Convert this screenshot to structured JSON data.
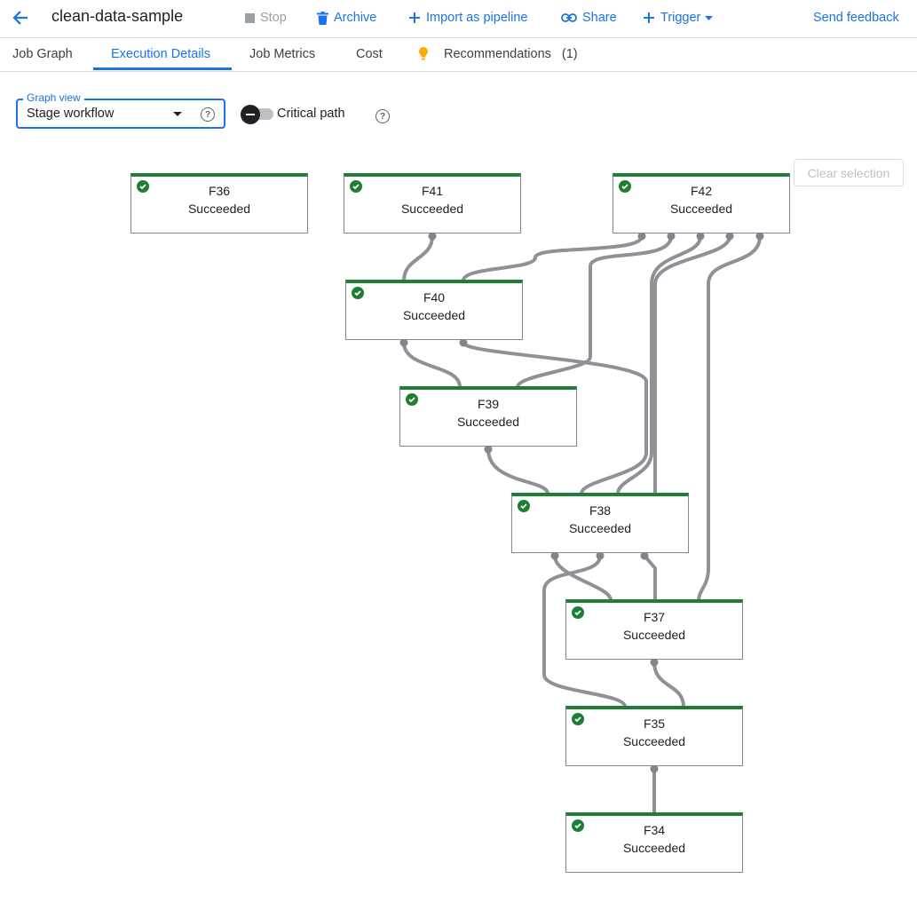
{
  "header": {
    "title": "clean-data-sample",
    "stop_label": "Stop",
    "archive_label": "Archive",
    "import_label": "Import as pipeline",
    "share_label": "Share",
    "trigger_label": "Trigger",
    "feedback_label": "Send feedback"
  },
  "tabs": [
    {
      "label": "Job Graph"
    },
    {
      "label": "Execution Details",
      "active": true
    },
    {
      "label": "Job Metrics"
    },
    {
      "label": "Cost"
    },
    {
      "label": "Recommendations",
      "count": "(1)"
    }
  ],
  "controls": {
    "graph_view_label": "Graph view",
    "graph_view_value": "Stage workflow",
    "critical_path_label": "Critical path",
    "critical_path_on": false,
    "clear_selection_label": "Clear selection"
  },
  "colors": {
    "accent": "#1a73e8",
    "success": "#1e7e34",
    "edge": "#8e9195"
  },
  "icons": [
    "back-arrow-icon",
    "stop-icon",
    "trash-icon",
    "plus-icon",
    "link-icon",
    "lightbulb-icon",
    "help-icon",
    "check-circle-icon"
  ],
  "graph": {
    "nodes": [
      {
        "name": "F36",
        "status": "Succeeded"
      },
      {
        "name": "F41",
        "status": "Succeeded"
      },
      {
        "name": "F42",
        "status": "Succeeded"
      },
      {
        "name": "F40",
        "status": "Succeeded"
      },
      {
        "name": "F39",
        "status": "Succeeded"
      },
      {
        "name": "F38",
        "status": "Succeeded"
      },
      {
        "name": "F37",
        "status": "Succeeded"
      },
      {
        "name": "F35",
        "status": "Succeeded"
      },
      {
        "name": "F34",
        "status": "Succeeded"
      }
    ],
    "edges": [
      [
        "F41",
        "F40"
      ],
      [
        "F42",
        "F40"
      ],
      [
        "F42",
        "F39"
      ],
      [
        "F42",
        "F38"
      ],
      [
        "F42",
        "F38"
      ],
      [
        "F42",
        "F37"
      ],
      [
        "F40",
        "F39"
      ],
      [
        "F40",
        "F38"
      ],
      [
        "F39",
        "F38"
      ],
      [
        "F38",
        "F37"
      ],
      [
        "F38",
        "F37"
      ],
      [
        "F38",
        "F35"
      ],
      [
        "F37",
        "F35"
      ],
      [
        "F35",
        "F34"
      ]
    ]
  }
}
